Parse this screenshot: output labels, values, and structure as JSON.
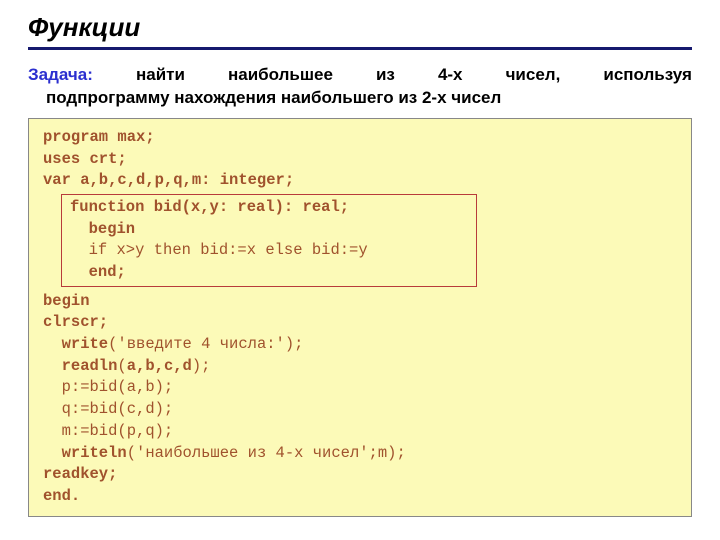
{
  "heading": "Функции",
  "task": {
    "label": "Задача:",
    "line1_words": [
      "найти",
      "наибольшее",
      "из",
      "4-х",
      "чисел,",
      "используя"
    ],
    "line2": "подпрограмму нахождения наибольшего из 2-х чисел"
  },
  "code": {
    "l1": "program max;",
    "l2": "uses crt;",
    "l3": "var a,b,c,d,p,q,m: integer;",
    "n1": "function bid(x,y: real): real;",
    "n2": "  begin",
    "n3": "  if x>y then bid:=x else bid:=y",
    "n4": "  end;",
    "l4": "begin",
    "l5": "clrscr;",
    "l6a": "  write",
    "l6b": "('введите 4 числа:');",
    "l7a": "  readln",
    "l7b": "(",
    "l7c": "a,b,c,d",
    "l7d": ");",
    "l8": "  p:=bid(a,b);",
    "l9": "  q:=bid(c,d);",
    "l10": "  m:=bid(p,q);",
    "l11a": "  writeln",
    "l11b": "('наибольшее из 4-х чисел';m);",
    "l12": "readkey;",
    "l13": "end."
  }
}
